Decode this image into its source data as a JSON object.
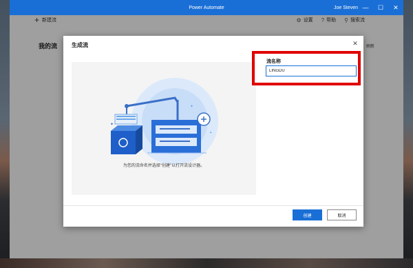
{
  "window": {
    "title": "Power Automate",
    "user": "Joe Steven",
    "controls": [
      "—",
      "☐",
      "✕"
    ]
  },
  "toolbar": {
    "new_flow": "新建流",
    "settings": "设置",
    "help": "帮助",
    "search": "搜索流"
  },
  "page": {
    "heading": "我的流",
    "refresh": "刷新"
  },
  "dialog": {
    "title": "生成流",
    "close": "✕",
    "caption": "为您的流命名并选择\"创建\"以打开流设计器。",
    "field_label": "流名称",
    "field_value": "LINGDU",
    "create_label": "创建",
    "cancel_label": "取消"
  },
  "colors": {
    "accent": "#1a6fd6",
    "highlight": "#e00000"
  }
}
